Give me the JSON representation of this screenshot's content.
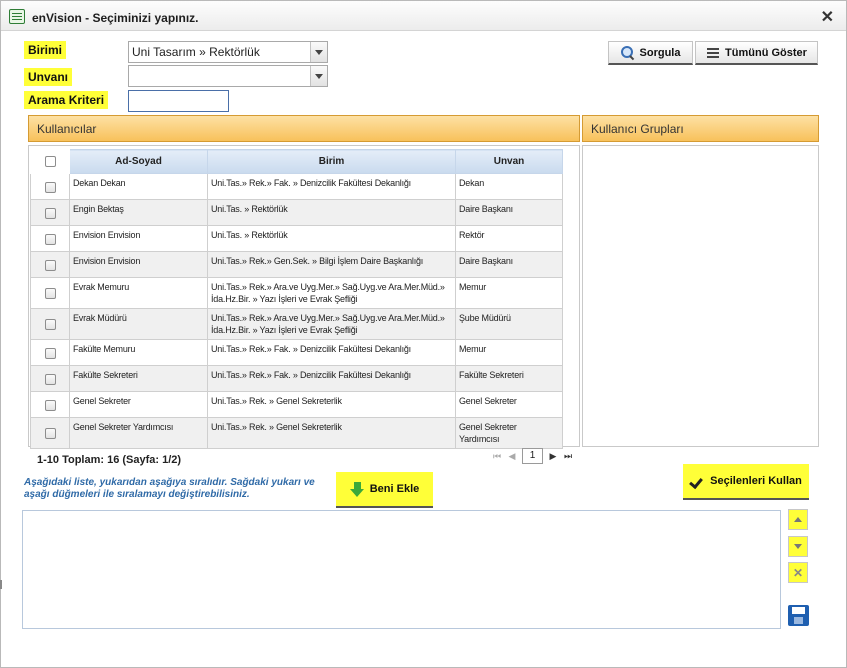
{
  "window": {
    "title": "enVision - Seçiminizi yapınız.",
    "close_icon": "close-icon"
  },
  "form": {
    "birimi_label": "Birimi",
    "birimi_value": "Uni Tasarım » Rektörlük",
    "unvani_label": "Unvanı",
    "unvani_value": "",
    "arama_label": "Arama Kriteri",
    "arama_value": ""
  },
  "toolbar": {
    "sorgula_label": "Sorgula",
    "tumunu_goster_label": "Tümünü Göster"
  },
  "panels": {
    "kullanicilar": "Kullanıcılar",
    "gruplar": "Kullanıcı Grupları"
  },
  "table": {
    "headers": [
      "Ad-Soyad",
      "Birim",
      "Unvan"
    ],
    "rows": [
      {
        "name": "Dekan Dekan",
        "birim": "Uni.Tas.» Rek.» Fak. » Denizcilik Fakültesi Dekanlığı",
        "unvan": "Dekan"
      },
      {
        "name": "Engin Bektaş",
        "birim": "Uni.Tas. » Rektörlük",
        "unvan": "Daire Başkanı"
      },
      {
        "name": "Envision Envision",
        "birim": "Uni.Tas. » Rektörlük",
        "unvan": "Rektör"
      },
      {
        "name": "Envision Envision",
        "birim": "Uni.Tas.» Rek.» Gen.Sek. » Bilgi İşlem Daire Başkanlığı",
        "unvan": "Daire Başkanı"
      },
      {
        "name": "Evrak Memuru",
        "birim": "Uni.Tas.» Rek.» Ara.ve Uyg.Mer.» Sağ.Uyg.ve Ara.Mer.Müd.» İda.Hz.Bir. » Yazı İşleri ve Evrak Şefliği",
        "unvan": "Memur"
      },
      {
        "name": "Evrak Müdürü",
        "birim": "Uni.Tas.» Rek.» Ara.ve Uyg.Mer.» Sağ.Uyg.ve Ara.Mer.Müd.» İda.Hz.Bir. » Yazı İşleri ve Evrak Şefliği",
        "unvan": "Şube Müdürü"
      },
      {
        "name": "Fakülte Memuru",
        "birim": "Uni.Tas.» Rek.» Fak. » Denizcilik Fakültesi Dekanlığı",
        "unvan": "Memur"
      },
      {
        "name": "Fakülte Sekreteri",
        "birim": "Uni.Tas.» Rek.» Fak. » Denizcilik Fakültesi Dekanlığı",
        "unvan": "Fakülte Sekreteri"
      },
      {
        "name": "Genel Sekreter",
        "birim": "Uni.Tas.» Rek. » Genel Sekreterlik",
        "unvan": "Genel Sekreter"
      },
      {
        "name": "Genel Sekreter Yardımcısı",
        "birim": "Uni.Tas.» Rek. » Genel Sekreterlik",
        "unvan": "Genel Sekreter Yardımcısı"
      }
    ]
  },
  "pager": {
    "info": "1-10 Toplam: 16   (Sayfa: 1/2)",
    "page": "1",
    "first": "⏮",
    "prev": "◀",
    "next": "▶",
    "last": "⏭"
  },
  "bottom": {
    "hint": "Aşağıdaki liste, yukarıdan aşağıya sıralıdır. Sağdaki yukarı ve aşağı düğmeleri ile sıralamayı değiştirebilisiniz.",
    "beni_ekle": "Beni Ekle",
    "secilenleri_kullan": "Seçilenleri Kullan"
  },
  "colors": {
    "highlight": "#ffff38",
    "panel_header": "#f8c15b",
    "hint_text": "#2f6aa7",
    "save_icon": "#1f5fb0"
  }
}
